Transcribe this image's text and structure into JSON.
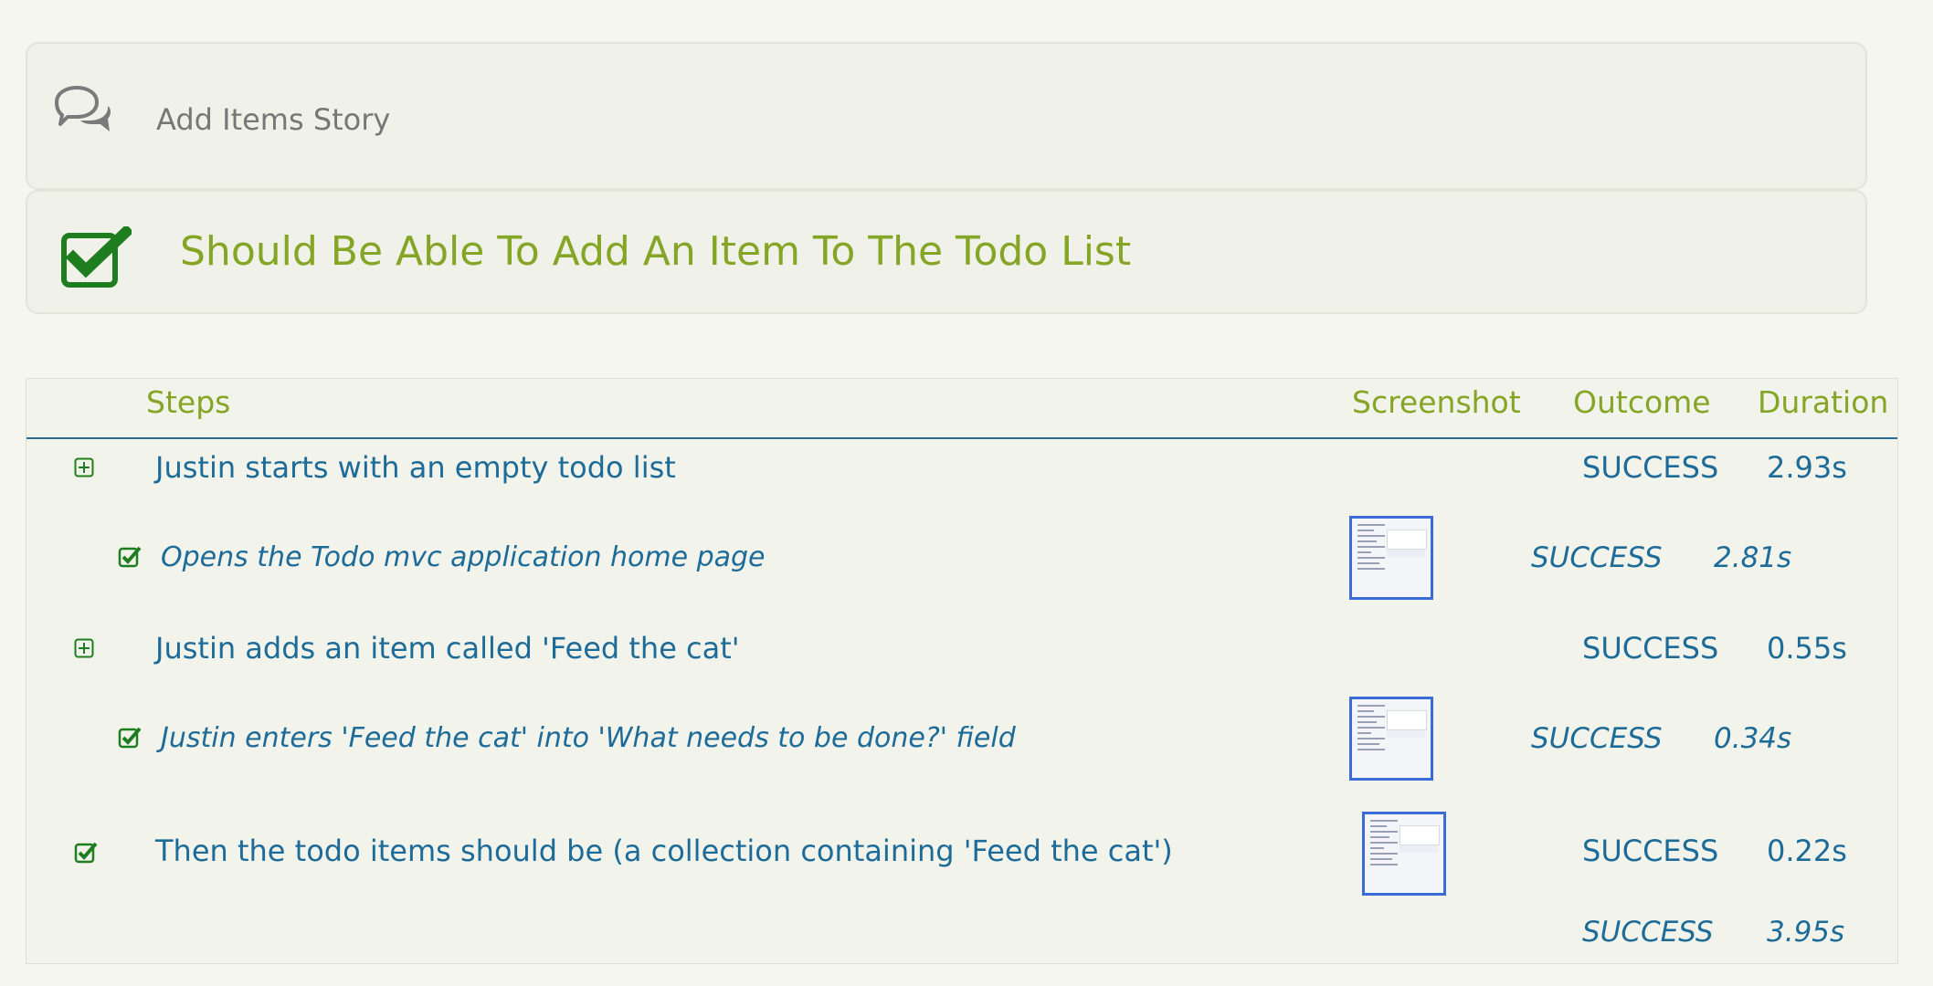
{
  "story": {
    "title": "Add Items Story",
    "icon": "speech-bubbles-icon"
  },
  "scenario": {
    "title": "Should Be Able To Add An Item To The Todo List",
    "icon": "checked-box-icon",
    "status_color": "#1e7d1e"
  },
  "table": {
    "headers": {
      "steps": "Steps",
      "screenshot": "Screenshot",
      "outcome": "Outcome",
      "duration": "Duration"
    },
    "rows": [
      {
        "text": "Justin starts with an empty todo list",
        "outcome": "SUCCESS",
        "duration": "2.93s",
        "icon": "expand-plus-icon",
        "has_screenshot": false
      },
      {
        "text": "Opens the Todo mvc application home page",
        "outcome": "SUCCESS",
        "duration": "2.81s",
        "icon": "success-check-icon",
        "has_screenshot": true
      },
      {
        "text": "Justin adds an item called 'Feed the cat'",
        "outcome": "SUCCESS",
        "duration": "0.55s",
        "icon": "expand-plus-icon",
        "has_screenshot": false
      },
      {
        "text": "Justin enters 'Feed the cat' into 'What needs to be done?' field",
        "outcome": "SUCCESS",
        "duration": "0.34s",
        "icon": "success-check-icon",
        "has_screenshot": true
      },
      {
        "text": "Then the todo items should be (a collection containing 'Feed the cat')",
        "outcome": "SUCCESS",
        "duration": "0.22s",
        "icon": "success-check-icon",
        "has_screenshot": true
      }
    ],
    "total": {
      "outcome": "SUCCESS",
      "duration": "3.95s"
    }
  },
  "colors": {
    "accent_green": "#84a525",
    "link_blue": "#1d6b98",
    "check_green": "#1e7d1e",
    "thumbnail_border": "#3a6bd6"
  }
}
